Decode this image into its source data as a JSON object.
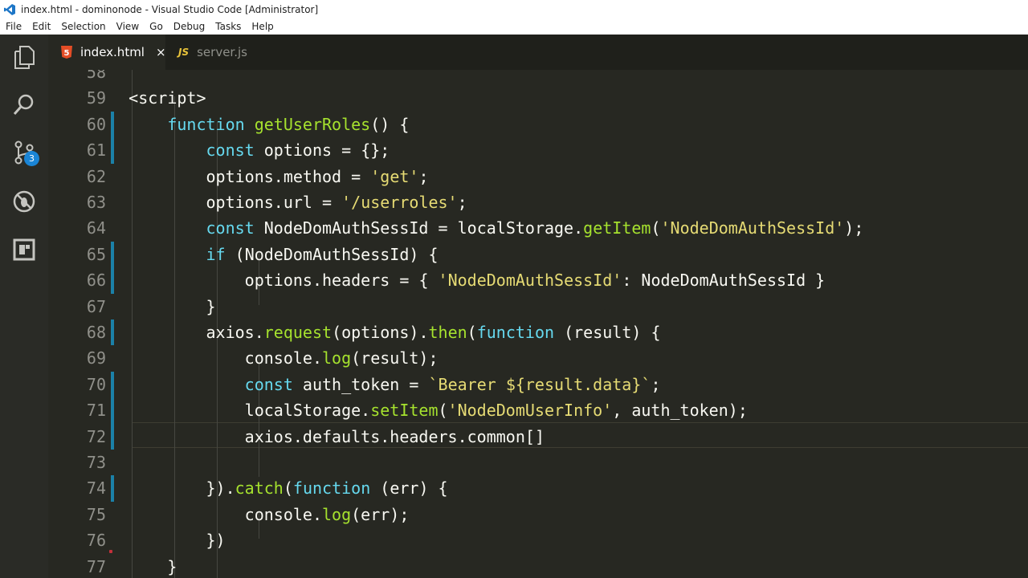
{
  "window": {
    "title": "index.html - dominonode - Visual Studio Code [Administrator]"
  },
  "menu": [
    "File",
    "Edit",
    "Selection",
    "View",
    "Go",
    "Debug",
    "Tasks",
    "Help"
  ],
  "activity": {
    "scm_badge": "3"
  },
  "tabs": [
    {
      "label": "index.html",
      "icon_text": "5",
      "close": "×"
    },
    {
      "label": "server.js",
      "icon_text": "JS"
    }
  ],
  "editor": {
    "lines": [
      {
        "num": "58",
        "text": ""
      },
      {
        "num": "59",
        "text": "    <script>"
      },
      {
        "num": "60",
        "text": "        function getUserRoles() {"
      },
      {
        "num": "61",
        "text": "            const options = {};"
      },
      {
        "num": "62",
        "text": "            options.method = 'get';"
      },
      {
        "num": "63",
        "text": "            options.url = '/userroles';"
      },
      {
        "num": "64",
        "text": "            const NodeDomAuthSessId = localStorage.getItem('NodeDomAuthSessId');"
      },
      {
        "num": "65",
        "text": "            if (NodeDomAuthSessId) {"
      },
      {
        "num": "66",
        "text": "                options.headers = { 'NodeDomAuthSessId': NodeDomAuthSessId }"
      },
      {
        "num": "67",
        "text": "            }"
      },
      {
        "num": "68",
        "text": "            axios.request(options).then(function (result) {"
      },
      {
        "num": "69",
        "text": "                console.log(result);"
      },
      {
        "num": "70",
        "text": "                const auth_token = `Bearer ${result.data}`;"
      },
      {
        "num": "71",
        "text": "                localStorage.setItem('NodeDomUserInfo', auth_token);"
      },
      {
        "num": "72",
        "text": "                axios.defaults.headers.common[]"
      },
      {
        "num": "73",
        "text": ""
      },
      {
        "num": "74",
        "text": "            }).catch(function (err) {"
      },
      {
        "num": "75",
        "text": "                console.log(err);"
      },
      {
        "num": "76",
        "text": "            })"
      },
      {
        "num": "77",
        "text": "        }"
      }
    ]
  },
  "colors": {
    "keyword": "#66d9ef",
    "function": "#a6e22e",
    "string": "#e6db74",
    "background": "#272822",
    "modified_gutter": "#1b81a8"
  }
}
